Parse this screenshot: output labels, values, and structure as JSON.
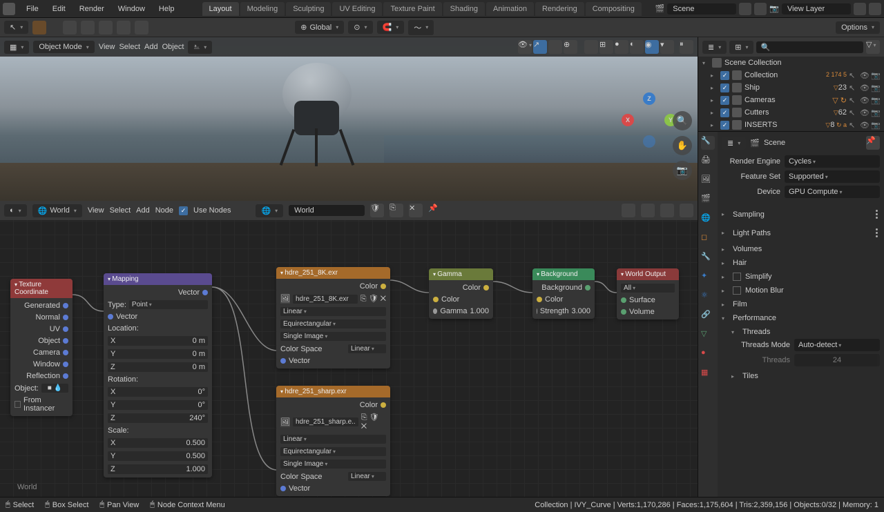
{
  "topbar": {
    "menus": [
      "File",
      "Edit",
      "Render",
      "Window",
      "Help"
    ],
    "workspace_tabs": [
      "Layout",
      "Modeling",
      "Sculpting",
      "UV Editing",
      "Texture Paint",
      "Shading",
      "Animation",
      "Rendering",
      "Compositing"
    ],
    "active_workspace": 0,
    "scene": "Scene",
    "view_layer": "View Layer"
  },
  "viewport": {
    "header": {
      "mode": "Object Mode",
      "menus": [
        "View",
        "Select",
        "Add",
        "Object"
      ],
      "orientation": "Global",
      "options": "Options"
    },
    "gizmo": {
      "x": "X",
      "y": "Y",
      "z": "Z"
    }
  },
  "node_editor": {
    "header": {
      "shader_type": "World",
      "menus": [
        "View",
        "Select",
        "Add",
        "Node"
      ],
      "use_nodes_label": "Use Nodes",
      "world_name": "World"
    },
    "world_label": "World",
    "nodes": {
      "texcoord": {
        "title": "Texture Coordinate",
        "outputs": [
          "Generated",
          "Normal",
          "UV",
          "Object",
          "Camera",
          "Window",
          "Reflection"
        ],
        "object_label": "Object:",
        "from_instancer": "From Instancer"
      },
      "mapping": {
        "title": "Mapping",
        "out_vector": "Vector",
        "type_label": "Type:",
        "type_value": "Point",
        "in_vector": "Vector",
        "location_label": "Location:",
        "loc": [
          {
            "axis": "X",
            "v": "0 m"
          },
          {
            "axis": "Y",
            "v": "0 m"
          },
          {
            "axis": "Z",
            "v": "0 m"
          }
        ],
        "rotation_label": "Rotation:",
        "rot": [
          {
            "axis": "X",
            "v": "0°"
          },
          {
            "axis": "Y",
            "v": "0°"
          },
          {
            "axis": "Z",
            "v": "240°"
          }
        ],
        "scale_label": "Scale:",
        "scale": [
          {
            "axis": "X",
            "v": "0.500"
          },
          {
            "axis": "Y",
            "v": "0.500"
          },
          {
            "axis": "Z",
            "v": "1.000"
          }
        ]
      },
      "env1": {
        "title": "hdre_251_8K.exr",
        "out_color": "Color",
        "file": "hdre_251_8K.exr",
        "interp": "Linear",
        "proj": "Equirectangular",
        "single": "Single Image",
        "cs_label": "Color Space",
        "cs_value": "Linear",
        "in_vector": "Vector"
      },
      "env2": {
        "title": "hdre_251_sharp.exr",
        "out_color": "Color",
        "file": "hdre_251_sharp.e..",
        "interp": "Linear",
        "proj": "Equirectangular",
        "single": "Single Image",
        "cs_label": "Color Space",
        "cs_value": "Linear",
        "in_vector": "Vector"
      },
      "gamma": {
        "title": "Gamma",
        "out_color": "Color",
        "in_color": "Color",
        "gamma_label": "Gamma",
        "gamma_value": "1.000"
      },
      "background": {
        "title": "Background",
        "out": "Background",
        "in_color": "Color",
        "strength_label": "Strength",
        "strength_value": "3.000"
      },
      "output": {
        "title": "World Output",
        "target": "All",
        "surface": "Surface",
        "volume": "Volume"
      }
    }
  },
  "outliner": {
    "root": "Scene Collection",
    "items": [
      {
        "name": "Collection",
        "badges": "2 174 5"
      },
      {
        "name": "Ship",
        "badges": "23"
      },
      {
        "name": "Cameras",
        "badges": ""
      },
      {
        "name": "Cutters",
        "badges": "62"
      },
      {
        "name": "INSERTS",
        "badges": "8"
      }
    ]
  },
  "properties": {
    "scene_name": "Scene",
    "render_engine_label": "Render Engine",
    "render_engine": "Cycles",
    "feature_set_label": "Feature Set",
    "feature_set": "Supported",
    "device_label": "Device",
    "device": "GPU Compute",
    "sections": [
      "Sampling",
      "Light Paths",
      "Volumes",
      "Hair",
      "Simplify",
      "Motion Blur",
      "Film",
      "Performance"
    ],
    "threads_label": "Threads",
    "threads_mode_label": "Threads Mode",
    "threads_mode": "Auto-detect",
    "threads_count_label": "Threads",
    "threads_count": "24",
    "tiles_label": "Tiles"
  },
  "statusbar": {
    "select": "Select",
    "box_select": "Box Select",
    "pan_view": "Pan View",
    "context_menu": "Node Context Menu",
    "info": "Collection | IVY_Curve | Verts:1,170,286 | Faces:1,175,604 | Tris:2,359,156 | Objects:0/32 | Memory: 1"
  }
}
